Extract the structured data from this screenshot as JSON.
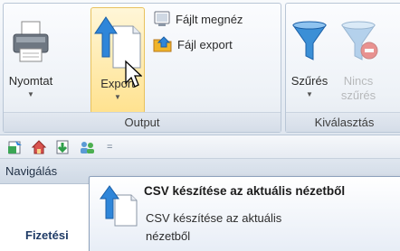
{
  "ribbon": {
    "output_group": {
      "footer": "Output",
      "print_label": "Nyomtat",
      "export_label": "Export",
      "view_file_label": "Fájlt megnéz",
      "file_export_label": "Fájl export"
    },
    "kiv_group": {
      "footer": "Kiválasztás",
      "filter_label": "Szűrés",
      "no_filter_label_1": "Nincs",
      "no_filter_label_2": "szűrés"
    }
  },
  "qat": {
    "icons": [
      "export-csv-icon",
      "home-icon",
      "download-icon",
      "users-icon"
    ],
    "more_glyph": "="
  },
  "nav": {
    "label": "Navigálás"
  },
  "content": {
    "payment_label": "Fizetési"
  },
  "tooltip": {
    "title": "CSV készítése az aktuális nézetből",
    "description": "CSV készítése az aktuális nézetből"
  }
}
